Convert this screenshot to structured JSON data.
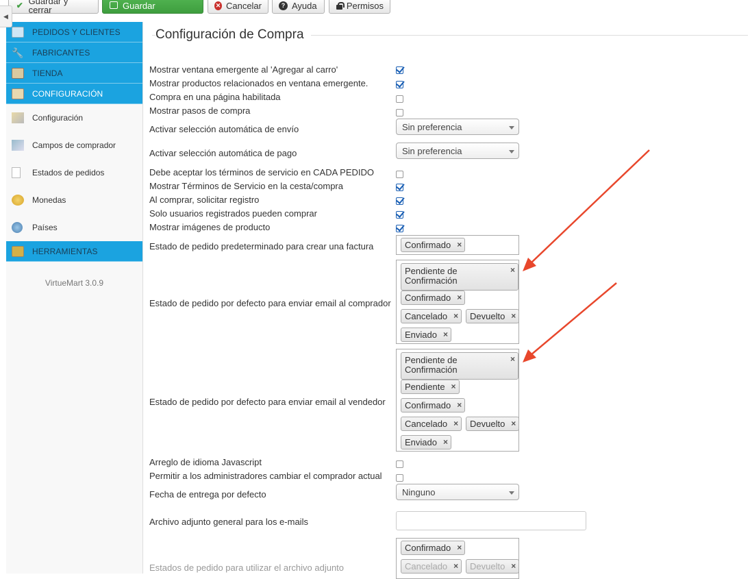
{
  "toolbar": {
    "save_close": "Guardar y cerrar",
    "save": "Guardar",
    "cancel": "Cancelar",
    "help": "Ayuda",
    "permissions": "Permisos"
  },
  "sidebar": {
    "sections": [
      {
        "label": "PEDIDOS Y CLIENTES",
        "icon": "orders-icon"
      },
      {
        "label": "FABRICANTES",
        "icon": "wrench-icon"
      },
      {
        "label": "TIENDA",
        "icon": "store-icon"
      },
      {
        "label": "CONFIGURACIÓN",
        "icon": "tools-icon"
      }
    ],
    "items": [
      {
        "label": "Configuración",
        "icon": "tools-icon"
      },
      {
        "label": "Campos de comprador",
        "icon": "form-icon"
      },
      {
        "label": "Estados de pedidos",
        "icon": "document-icon"
      },
      {
        "label": "Monedas",
        "icon": "coins-icon"
      },
      {
        "label": "Países",
        "icon": "globe-icon"
      }
    ],
    "tools": {
      "label": "HERRAMIENTAS",
      "icon": "toolbox-icon"
    },
    "version": "VirtueMart 3.0.9"
  },
  "main": {
    "title": "Configuración de Compra",
    "rows": {
      "r1": {
        "label": "Mostrar ventana emergente al 'Agregar al carro'",
        "checked": true
      },
      "r2": {
        "label": "Mostrar productos relacionados en ventana emergente.",
        "checked": true
      },
      "r3": {
        "label": "Compra en una página habilitada",
        "checked": false
      },
      "r4": {
        "label": "Mostrar pasos de compra",
        "checked": false
      },
      "r5": {
        "label": "Activar selección automática de envío",
        "value": "Sin preferencia"
      },
      "r6": {
        "label": "Activar selección automática de pago",
        "value": "Sin preferencia"
      },
      "r7": {
        "label": "Debe aceptar los términos de servicio en CADA PEDIDO",
        "checked": false
      },
      "r8": {
        "label": "Mostrar Términos de Servicio en la cesta/compra",
        "checked": true
      },
      "r9": {
        "label": "Al comprar, solicitar registro",
        "checked": true
      },
      "r10": {
        "label": "Solo usuarios registrados pueden comprar",
        "checked": true
      },
      "r11": {
        "label": "Mostrar imágenes de producto",
        "checked": true
      },
      "r12": {
        "label": "Estado de pedido predeterminado para crear una factura",
        "chips": [
          "Confirmado"
        ]
      },
      "r13": {
        "label": "Estado de pedido por defecto para enviar email al comprador",
        "chips": [
          "Pendiente de Confirmación",
          "Confirmado",
          "Cancelado",
          "Devuelto",
          "Enviado"
        ]
      },
      "r14": {
        "label": "Estado de pedido por defecto para enviar email al vendedor",
        "chips": [
          "Pendiente de Confirmación",
          "Pendiente",
          "Confirmado",
          "Cancelado",
          "Devuelto",
          "Enviado"
        ]
      },
      "r15": {
        "label": "Arreglo de idioma Javascript",
        "checked": false
      },
      "r16": {
        "label": "Permitir a los administradores cambiar el comprador actual",
        "checked": false
      },
      "r17": {
        "label": "Fecha de entrega por defecto",
        "value": "Ninguno"
      },
      "r18": {
        "label": "Archivo adjunto general para los e-mails",
        "value": ""
      },
      "r19": {
        "label": "Estados de pedido para utilizar el archivo adjunto",
        "chips": [
          "Confirmado",
          "Cancelado",
          "Devuelto"
        ]
      }
    },
    "chip_remove": "×"
  },
  "colors": {
    "menu_blue": "#1ba3e0",
    "save_green": "#45a845",
    "arrow_red": "#e8472c"
  }
}
